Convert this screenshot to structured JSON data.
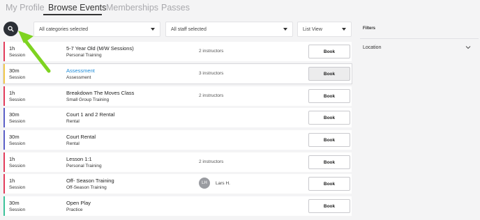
{
  "nav": {
    "tabs": [
      {
        "label": "My Profile"
      },
      {
        "label": "Browse Events"
      },
      {
        "label": "Memberships"
      },
      {
        "label": "Passes"
      }
    ]
  },
  "toolbar": {
    "category_select": "All categories selected",
    "staff_select": "All staff selected",
    "view_select": "List View"
  },
  "filters": {
    "title": "Filters",
    "location_label": "Location"
  },
  "events": [
    {
      "duration": "1h",
      "type": "Session",
      "title": "5-7 Year Old (M/W Sessions)",
      "subtitle": "Personal Training",
      "instructors": "2 instructors",
      "staff": "",
      "avatar": "",
      "accent": "#e23c5b",
      "book": "Book"
    },
    {
      "duration": "30m",
      "type": "Session",
      "title": "Assessment",
      "subtitle": "Assessment",
      "instructors": "3 instructors",
      "staff": "",
      "avatar": "",
      "accent": "#f2c94c",
      "book": "Book"
    },
    {
      "duration": "1h",
      "type": "Session",
      "title": "Breakdown The Moves Class",
      "subtitle": "Small Group Training",
      "instructors": "2 instructors",
      "staff": "",
      "avatar": "",
      "accent": "#e23c5b",
      "book": "Book"
    },
    {
      "duration": "30m",
      "type": "Session",
      "title": "Court 1 and 2 Rental",
      "subtitle": "Rental",
      "instructors": "",
      "staff": "",
      "avatar": "",
      "accent": "#5b5fc7",
      "book": "Book"
    },
    {
      "duration": "30m",
      "type": "Session",
      "title": "Court Rental",
      "subtitle": "Rental",
      "instructors": "",
      "staff": "",
      "avatar": "",
      "accent": "#5b5fc7",
      "book": "Book"
    },
    {
      "duration": "1h",
      "type": "Session",
      "title": "Lesson 1:1",
      "subtitle": "Personal Training",
      "instructors": "2 instructors",
      "staff": "",
      "avatar": "",
      "accent": "#e23c5b",
      "book": "Book"
    },
    {
      "duration": "1h",
      "type": "Session",
      "title": "Off- Season Training",
      "subtitle": "Off-Season Training",
      "instructors": "",
      "staff": "Lars H.",
      "avatar": "LH",
      "accent": "#e23c5b",
      "book": "Book"
    },
    {
      "duration": "30m",
      "type": "Session",
      "title": "Open Play",
      "subtitle": "Practice",
      "instructors": "",
      "staff": "",
      "avatar": "",
      "accent": "#3cc29a",
      "book": "Book"
    }
  ],
  "colors": {
    "accent_link": "#1d8bd8",
    "annotation_arrow": "#7ed321"
  }
}
